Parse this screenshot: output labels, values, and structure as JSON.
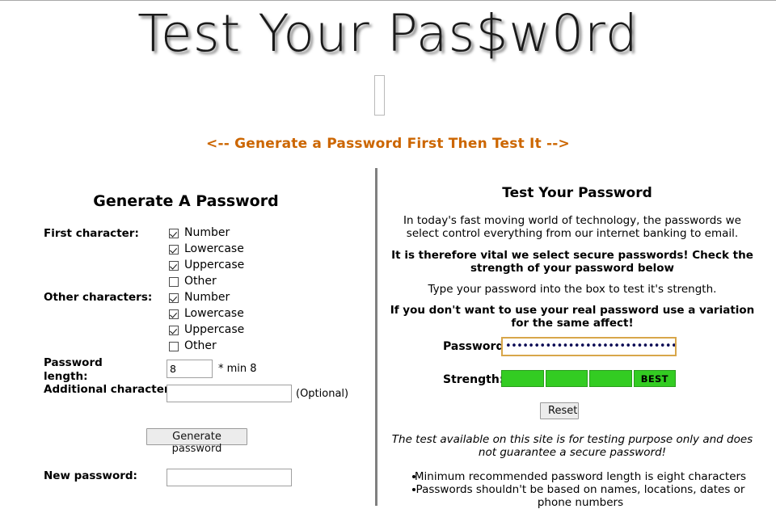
{
  "header": {
    "title": "Test Your Pas$w0rd",
    "subtitle": "<-- Generate a Password First Then Test It -->",
    "subtitle_color": "#cc6600"
  },
  "generate_panel": {
    "heading": "Generate A Password",
    "first_character_label": "First character:",
    "first_character_options": [
      {
        "label": "Number",
        "checked": true
      },
      {
        "label": "Lowercase",
        "checked": true
      },
      {
        "label": "Uppercase",
        "checked": true
      },
      {
        "label": "Other",
        "checked": false
      }
    ],
    "other_characters_label": "Other characters:",
    "other_characters_options": [
      {
        "label": "Number",
        "checked": true
      },
      {
        "label": "Lowercase",
        "checked": true
      },
      {
        "label": "Uppercase",
        "checked": true
      },
      {
        "label": "Other",
        "checked": false
      }
    ],
    "password_length_label": "Password length:",
    "password_length_value": "8",
    "password_length_note": "* min 8",
    "additional_characters_label": "Additional characters:",
    "additional_characters_value": "",
    "additional_characters_note": "(Optional)",
    "generate_button": "Generate password",
    "new_password_label": "New password:",
    "new_password_value": ""
  },
  "test_panel": {
    "heading": "Test Your Password",
    "intro": "In today's fast moving world of technology, the passwords we select control everything from our internet banking to email.",
    "vital": "It is therefore vital we select secure passwords! Check the strength of your password below",
    "type_hint": "Type your password into the box to test it's strength.",
    "variation": "If you don't want to use your real password use a variation for the same affect!",
    "password_label": "Password:",
    "password_masked": "•••••••••••••••••••••••••••••••••••",
    "strength_label": "Strength:",
    "strength_segments": [
      "",
      "",
      "",
      "BEST"
    ],
    "strength_color": "#33cc22",
    "strength_level": 4,
    "reset_button": "Reset",
    "disclaimer": "The test available on this site is for testing purpose only and does not guarantee a secure password!",
    "tips": [
      "Minimum recommended password length is eight characters",
      "Passwords shouldn't be based on names, locations, dates or phone numbers"
    ]
  }
}
